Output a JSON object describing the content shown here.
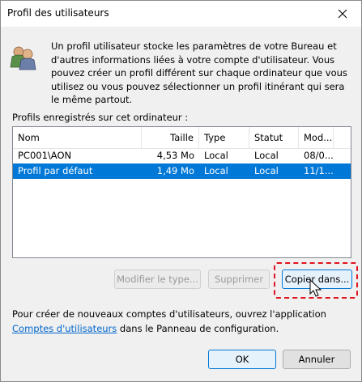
{
  "window": {
    "title": "Profil des utilisateurs",
    "close_glyph": "✕"
  },
  "description": "Un profil utilisateur stocke les paramètres de votre Bureau et d'autres informations liées à votre compte d'utilisateur. Vous pouvez créer un profil différent sur chaque ordinateur que vous utilisez ou vous pouvez sélectionner un profil itinérant qui sera le même partout.",
  "profiles_label": "Profils enregistrés sur cet ordinateur :",
  "list": {
    "columns": [
      "Nom",
      "Taille",
      "Type",
      "Statut",
      "Mod..."
    ],
    "rows": [
      {
        "name": "PC001\\AON",
        "size": "4,53 Mo",
        "type": "Local",
        "status": "Local",
        "modified": "08/0...",
        "selected": false
      },
      {
        "name": "Profil par défaut",
        "size": "1,49 Mo",
        "type": "Local",
        "status": "Local",
        "modified": "11/1...",
        "selected": true
      }
    ]
  },
  "buttons": {
    "modify_type": "Modifier le type...",
    "delete": "Supprimer",
    "copy_to": "Copier dans...",
    "ok": "OK",
    "cancel": "Annuler"
  },
  "footer": {
    "text_before": "Pour créer de nouveaux comptes d'utilisateurs, ouvrez l'application",
    "link": "Comptes d'utilisateurs",
    "text_after": " dans le Panneau de configuration."
  },
  "colors": {
    "selection": "#0078d7",
    "highlight_border": "#e0141e",
    "link": "#0066cc"
  }
}
